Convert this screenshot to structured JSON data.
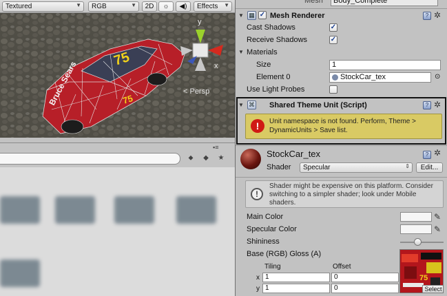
{
  "scene": {
    "toolbar": {
      "render_mode": "Textured",
      "color_mode": "RGB",
      "mode_2d": "2D",
      "lighting_icon": "sun-icon",
      "audio_icon": "speaker-icon",
      "effects": "Effects"
    },
    "gizmo": {
      "y_label": "y",
      "x_label": "x",
      "persp_label": "< Persp"
    },
    "car": {
      "number": "75",
      "side_text": "Bruce Sears"
    }
  },
  "project": {
    "search_placeholder": "",
    "icons": [
      "filter-icon",
      "label-icon",
      "star-icon"
    ]
  },
  "inspector": {
    "top_partial": {
      "label": "Mesh",
      "value": "Body_Complete"
    },
    "mesh_renderer": {
      "title": "Mesh Renderer",
      "enabled": true,
      "cast_shadows_label": "Cast Shadows",
      "cast_shadows": true,
      "receive_shadows_label": "Receive Shadows",
      "receive_shadows": true,
      "materials_label": "Materials",
      "size_label": "Size",
      "size_value": "1",
      "element0_label": "Element 0",
      "element0_value": "StockCar_tex",
      "use_light_probes_label": "Use Light Probes",
      "use_light_probes": false
    },
    "shared_theme_unit": {
      "title": "Shared Theme Unit (Script)",
      "warning_text": "Unit namespace is not found. Perform, Theme > DynamicUnits > Save list."
    },
    "material": {
      "name": "StockCar_tex",
      "shader_label": "Shader",
      "shader_value": "Specular",
      "edit_button": "Edit...",
      "info_text": "Shader might be expensive on this platform. Consider switching to a simpler shader; look under Mobile shaders.",
      "main_color_label": "Main Color",
      "specular_color_label": "Specular Color",
      "shininess_label": "Shininess",
      "shininess_level": 0.4,
      "base_label": "Base (RGB) Gloss (A)",
      "tiling_label": "Tiling",
      "offset_label": "Offset",
      "x_label": "x",
      "y_label": "y",
      "tiling_x": "1",
      "tiling_y": "1",
      "offset_x": "0",
      "offset_y": "0",
      "select_button": "Select"
    }
  },
  "colors": {
    "warning_bg": "#d9ca64",
    "error_icon": "#d01a15",
    "panel_bg": "#c2c2c2"
  }
}
